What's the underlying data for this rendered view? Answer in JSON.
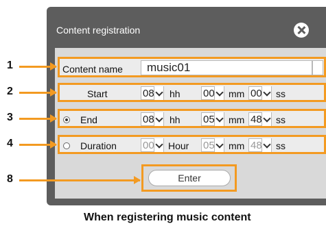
{
  "dialog": {
    "title": "Content registration"
  },
  "callouts": [
    "1",
    "2",
    "3",
    "4",
    "8"
  ],
  "content_name": {
    "label": "Content name",
    "value": "music01"
  },
  "start": {
    "label": "Start",
    "hh": "08",
    "mm": "00",
    "ss": "00",
    "hh_unit": "hh",
    "mm_unit": "mm",
    "ss_unit": "ss"
  },
  "end": {
    "label": "End",
    "selected": true,
    "hh": "08",
    "mm": "05",
    "ss": "48",
    "hh_unit": "hh",
    "mm_unit": "mm",
    "ss_unit": "ss"
  },
  "duration": {
    "label": "Duration",
    "selected": false,
    "hour": "00",
    "mm": "05",
    "ss": "48",
    "hour_unit": "Hour",
    "mm_unit": "mm",
    "ss_unit": "ss"
  },
  "enter_button": {
    "label": "Enter"
  },
  "caption": "When registering music content",
  "colors": {
    "highlight": "#f39a21",
    "dialog_bg": "#5d5d5d"
  }
}
